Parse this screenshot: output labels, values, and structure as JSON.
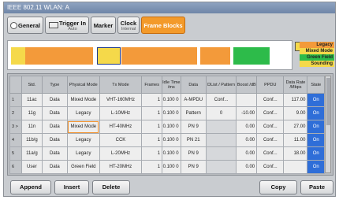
{
  "window": {
    "title": "IEEE 802.11 WLAN: A"
  },
  "tabs": [
    {
      "label": "General",
      "sub": ""
    },
    {
      "label": "Trigger In",
      "sub": "Auto"
    },
    {
      "label": "Marker",
      "sub": ""
    },
    {
      "label": "Clock",
      "sub": "Internal"
    },
    {
      "label": "Frame Blocks",
      "sub": ""
    }
  ],
  "legend": {
    "items": [
      {
        "label": "Legacy",
        "color": "#f39a3a"
      },
      {
        "label": "Mixed Mode",
        "color": "#f5d94a"
      },
      {
        "label": "Green Field",
        "color": "#2dbb4a"
      },
      {
        "label": "Sounding",
        "color": "#f5d94a"
      }
    ]
  },
  "table": {
    "columns": [
      "",
      "Std.",
      "Type",
      "Physical Mode",
      "Tx Mode",
      "Frames",
      "Idle Time /ms",
      "Data",
      "DList / Pattern",
      "Boost /dB",
      "PPDU",
      "Data Rate /Mbps",
      "State"
    ],
    "rows": [
      {
        "idx": "1",
        "std": "11ac",
        "type": "Data",
        "phys": "Mixed Mode",
        "tx": "VHT-160MHz",
        "frames": "1",
        "idle": "0.100 0",
        "data": "A-MPDU",
        "dlist": "Conf...",
        "boost": "",
        "ppdu": "Conf...",
        "rate": "117.00",
        "state": "On"
      },
      {
        "idx": "2",
        "std": "11g",
        "type": "Data",
        "phys": "Legacy",
        "tx": "L-10MHz",
        "frames": "1",
        "idle": "0.100 0",
        "data": "Pattern",
        "dlist": "0",
        "boost": "-10.00",
        "ppdu": "Conf...",
        "rate": "9.00",
        "state": "On"
      },
      {
        "idx": "3 >",
        "std": "11n",
        "type": "Data",
        "phys": "Mixed Mode",
        "tx": "HT-40MHz",
        "frames": "1",
        "idle": "0.100 0",
        "data": "PN 9",
        "dlist": "",
        "boost": "0.00",
        "ppdu": "Conf...",
        "rate": "27.00",
        "state": "On"
      },
      {
        "idx": "4",
        "std": "11b/g",
        "type": "Data",
        "phys": "Legacy",
        "tx": "CCK",
        "frames": "1",
        "idle": "0.100 0",
        "data": "PN 21",
        "dlist": "",
        "boost": "0.00",
        "ppdu": "Conf...",
        "rate": "11.00",
        "state": "On"
      },
      {
        "idx": "5",
        "std": "11a/g",
        "type": "Data",
        "phys": "Legacy",
        "tx": "L-20MHz",
        "frames": "1",
        "idle": "0.100 0",
        "data": "PN 9",
        "dlist": "",
        "boost": "0.00",
        "ppdu": "Conf...",
        "rate": "18.00",
        "state": "On"
      },
      {
        "idx": "6",
        "std": "User",
        "type": "Data",
        "phys": "Green Field",
        "tx": "HT-20MHz",
        "frames": "1",
        "idle": "0.100 0",
        "data": "PN 9",
        "dlist": "",
        "boost": "0.00",
        "ppdu": "Conf...",
        "rate": "",
        "state": "On"
      }
    ]
  },
  "buttons": {
    "append": "Append",
    "insert": "Insert",
    "delete": "Delete",
    "copy": "Copy",
    "paste": "Paste"
  },
  "colors": {
    "legacy": "#f39a3a",
    "mixed": "#f5d94a",
    "green_field": "#2dbb4a",
    "state_on": "#2f6ed8",
    "selection": "#1e3a8a"
  }
}
